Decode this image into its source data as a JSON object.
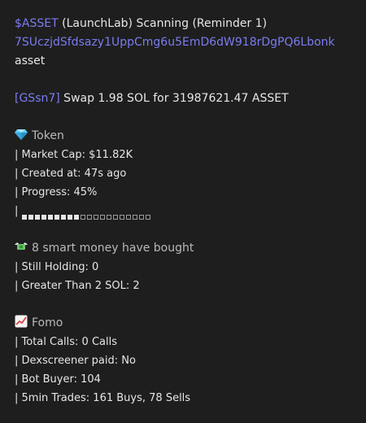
{
  "header": {
    "ticker": "$ASSET",
    "title_rest": " (LaunchLab) Scanning (Reminder 1)",
    "address": "7SUczjdSfdsazy1UppCmg6u5EmD6dW918rDgPQ6Lbonk",
    "name": "asset"
  },
  "swap": {
    "wallet": "[GSsn7]",
    "text": " Swap 1.98 SOL for 31987621.47 ASSET"
  },
  "token": {
    "icon": "gem-icon",
    "heading": "Token",
    "market_cap": "| Market Cap: $11.82K",
    "created_at": "| Created at: 47s ago",
    "progress_label": "| Progress: 45%",
    "progress_prefix": "| ",
    "progress_value": 0.45,
    "progress_filled_segments": 9,
    "progress_total_segments": 20
  },
  "smart_money": {
    "icon": "money-wings-icon",
    "heading": "8 smart money have bought",
    "still_holding": "| Still Holding: 0",
    "greater_than": "| Greater Than 2 SOL: 2"
  },
  "fomo": {
    "icon": "chart-increasing-icon",
    "heading": "Fomo",
    "total_calls": "| Total Calls: 0 Calls",
    "dexscreener": "| Dexscreener paid: No",
    "bot_buyer": "| Bot Buyer: 104",
    "trades": "| 5min Trades: 161 Buys, 78 Sells"
  },
  "colors": {
    "background": "#1e1e1e",
    "text": "#e6e6e6",
    "link": "#7b7cf0",
    "muted": "#b9b9b9"
  }
}
